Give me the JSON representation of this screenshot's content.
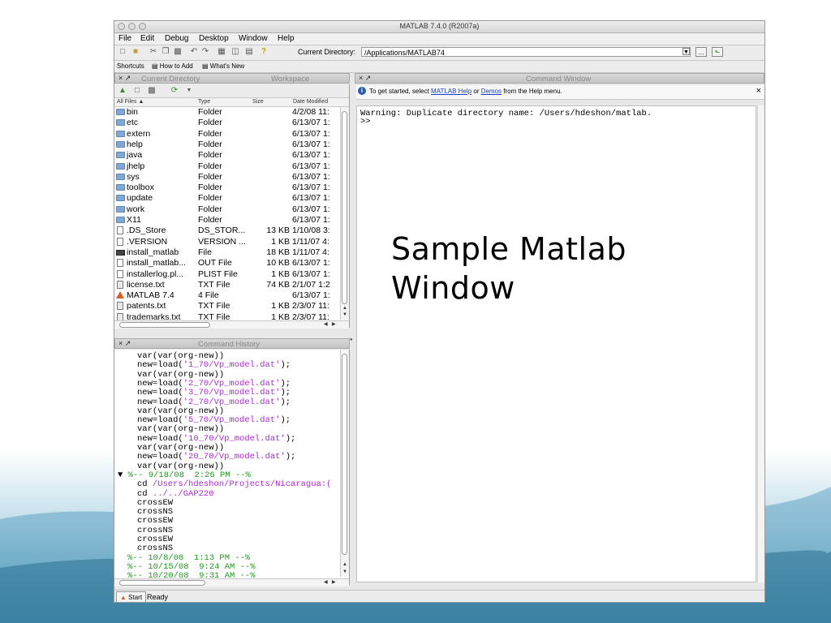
{
  "colors": {
    "slide_bg_top": "#ffffff",
    "slide_bg_bottom": "#3e86a8",
    "string_purple": "#b025d8",
    "comment_green": "#1e9a1e",
    "link_blue": "#1a3fcf"
  },
  "window": {
    "title": "MATLAB  7.4.0 (R2007a)"
  },
  "menu": [
    "File",
    "Edit",
    "Debug",
    "Desktop",
    "Window",
    "Help"
  ],
  "toolbar": {
    "icons": [
      "new-file-icon",
      "open-folder-icon",
      "cut-icon",
      "copy-icon",
      "paste-icon",
      "undo-icon",
      "redo-icon",
      "simulink-icon",
      "guide-icon",
      "profiler-icon",
      "help-icon"
    ],
    "current_directory_label": "Current Directory:",
    "current_directory_value": "/Applications/MATLAB74",
    "browse_label": "...",
    "up_label": "⬑"
  },
  "shortcuts": {
    "label": "Shortcuts",
    "items": [
      "How to Add",
      "What's New"
    ]
  },
  "current_directory_pane": {
    "tab_active": "Current Directory",
    "tab_inactive": "Workspace",
    "columns": [
      "All Files ▲",
      "Type",
      "Size",
      "Date Modified"
    ],
    "files": [
      {
        "name": "bin",
        "type": "Folder",
        "size": "",
        "date": "4/2/08 11:",
        "icon": "folder"
      },
      {
        "name": "etc",
        "type": "Folder",
        "size": "",
        "date": "6/13/07 1:",
        "icon": "folder"
      },
      {
        "name": "extern",
        "type": "Folder",
        "size": "",
        "date": "6/13/07 1:",
        "icon": "folder"
      },
      {
        "name": "help",
        "type": "Folder",
        "size": "",
        "date": "6/13/07 1:",
        "icon": "folder"
      },
      {
        "name": "java",
        "type": "Folder",
        "size": "",
        "date": "6/13/07 1:",
        "icon": "folder"
      },
      {
        "name": "jhelp",
        "type": "Folder",
        "size": "",
        "date": "6/13/07 1:",
        "icon": "folder"
      },
      {
        "name": "sys",
        "type": "Folder",
        "size": "",
        "date": "6/13/07 1:",
        "icon": "folder"
      },
      {
        "name": "toolbox",
        "type": "Folder",
        "size": "",
        "date": "6/13/07 1:",
        "icon": "folder"
      },
      {
        "name": "update",
        "type": "Folder",
        "size": "",
        "date": "6/13/07 1:",
        "icon": "folder"
      },
      {
        "name": "work",
        "type": "Folder",
        "size": "",
        "date": "6/13/07 1:",
        "icon": "folder"
      },
      {
        "name": "X11",
        "type": "Folder",
        "size": "",
        "date": "6/13/07 1:",
        "icon": "folder"
      },
      {
        "name": ".DS_Store",
        "type": "DS_STOR...",
        "size": "13 KB",
        "date": "1/10/08 3:",
        "icon": "file"
      },
      {
        "name": ".VERSION",
        "type": "VERSION ...",
        "size": "1 KB",
        "date": "1/11/07 4:",
        "icon": "file"
      },
      {
        "name": "install_matlab",
        "type": "File",
        "size": "18 KB",
        "date": "1/11/07 4:",
        "icon": "bin"
      },
      {
        "name": "install_matlab...",
        "type": "OUT File",
        "size": "10 KB",
        "date": "6/13/07 1:",
        "icon": "file"
      },
      {
        "name": "installerlog.pl...",
        "type": "PLIST File",
        "size": "1 KB",
        "date": "6/13/07 1:",
        "icon": "file"
      },
      {
        "name": "license.txt",
        "type": "TXT File",
        "size": "74 KB",
        "date": "2/1/07 1:2",
        "icon": "txt"
      },
      {
        "name": "MATLAB 7.4",
        "type": "4 File",
        "size": "",
        "date": "6/13/07 1:",
        "icon": "matlab"
      },
      {
        "name": "patents.txt",
        "type": "TXT File",
        "size": "1 KB",
        "date": "2/3/07 11:",
        "icon": "txt"
      },
      {
        "name": "trademarks.txt",
        "type": "TXT File",
        "size": "1 KB",
        "date": "2/3/07 11:",
        "icon": "txt"
      }
    ]
  },
  "command_history": {
    "title": "Command History",
    "lines": [
      {
        "indent": 2,
        "parts": [
          {
            "t": "var(var(org-new))",
            "c": "plain"
          }
        ]
      },
      {
        "indent": 2,
        "parts": [
          {
            "t": "new=load(",
            "c": "plain"
          },
          {
            "t": "'1_70/Vp_model.dat'",
            "c": "str"
          },
          {
            "t": ");",
            "c": "plain"
          }
        ]
      },
      {
        "indent": 2,
        "parts": [
          {
            "t": "var(var(org-new))",
            "c": "plain"
          }
        ]
      },
      {
        "indent": 2,
        "parts": [
          {
            "t": "new=load(",
            "c": "plain"
          },
          {
            "t": "'2_70/Vp_model.dat'",
            "c": "str"
          },
          {
            "t": ");",
            "c": "plain"
          }
        ]
      },
      {
        "indent": 2,
        "parts": [
          {
            "t": "new=load(",
            "c": "plain"
          },
          {
            "t": "'3_70/Vp_model.dat'",
            "c": "str"
          },
          {
            "t": ");",
            "c": "plain"
          }
        ]
      },
      {
        "indent": 2,
        "parts": [
          {
            "t": "new=load(",
            "c": "plain"
          },
          {
            "t": "'2_70/Vp_model.dat'",
            "c": "str"
          },
          {
            "t": ");",
            "c": "plain"
          }
        ]
      },
      {
        "indent": 2,
        "parts": [
          {
            "t": "var(var(org-new))",
            "c": "plain"
          }
        ]
      },
      {
        "indent": 2,
        "parts": [
          {
            "t": "new=load(",
            "c": "plain"
          },
          {
            "t": "'5_70/Vp_model.dat'",
            "c": "str"
          },
          {
            "t": ");",
            "c": "plain"
          }
        ]
      },
      {
        "indent": 2,
        "parts": [
          {
            "t": "var(var(org-new))",
            "c": "plain"
          }
        ]
      },
      {
        "indent": 2,
        "parts": [
          {
            "t": "new=load(",
            "c": "plain"
          },
          {
            "t": "'10_70/Vp_model.dat'",
            "c": "str"
          },
          {
            "t": ");",
            "c": "plain"
          }
        ]
      },
      {
        "indent": 2,
        "parts": [
          {
            "t": "var(var(org-new))",
            "c": "plain"
          }
        ]
      },
      {
        "indent": 2,
        "parts": [
          {
            "t": "new=load(",
            "c": "plain"
          },
          {
            "t": "'20_70/Vp_model.dat'",
            "c": "str"
          },
          {
            "t": ");",
            "c": "plain"
          }
        ]
      },
      {
        "indent": 2,
        "parts": [
          {
            "t": "var(var(org-new))",
            "c": "plain"
          }
        ]
      },
      {
        "indent": 0,
        "parts": [
          {
            "t": "▼ ",
            "c": "plain"
          },
          {
            "t": "%-- 9/18/08  2:26 PM --%",
            "c": "cmt"
          }
        ]
      },
      {
        "indent": 2,
        "parts": [
          {
            "t": "cd ",
            "c": "plain"
          },
          {
            "t": "/Users/hdeshon/Projects/Nicaragua:(",
            "c": "str"
          }
        ]
      },
      {
        "indent": 2,
        "parts": [
          {
            "t": "cd ",
            "c": "plain"
          },
          {
            "t": "../../GAP220",
            "c": "str"
          }
        ]
      },
      {
        "indent": 2,
        "parts": [
          {
            "t": "crossEW",
            "c": "plain"
          }
        ]
      },
      {
        "indent": 2,
        "parts": [
          {
            "t": "crossNS",
            "c": "plain"
          }
        ]
      },
      {
        "indent": 2,
        "parts": [
          {
            "t": "crossEW",
            "c": "plain"
          }
        ]
      },
      {
        "indent": 2,
        "parts": [
          {
            "t": "crossNS",
            "c": "plain"
          }
        ]
      },
      {
        "indent": 2,
        "parts": [
          {
            "t": "crossEW",
            "c": "plain"
          }
        ]
      },
      {
        "indent": 2,
        "parts": [
          {
            "t": "crossNS",
            "c": "plain"
          }
        ]
      },
      {
        "indent": 1,
        "parts": [
          {
            "t": "%-- 10/8/08  1:13 PM --%",
            "c": "cmt"
          }
        ]
      },
      {
        "indent": 1,
        "parts": [
          {
            "t": "%-- 10/15/08  9:24 AM --%",
            "c": "cmt"
          }
        ]
      },
      {
        "indent": 1,
        "parts": [
          {
            "t": "%-- 10/20/08  9:31 AM --%",
            "c": "cmt"
          }
        ]
      }
    ]
  },
  "command_window": {
    "title": "Command Window",
    "tip_prefix": "To get started, select ",
    "tip_link1": "MATLAB Help",
    "tip_mid": " or ",
    "tip_link2": "Demos",
    "tip_suffix": " from the Help menu.",
    "close_label": "×",
    "output": [
      "Warning: Duplicate directory name: /Users/hdeshon/matlab.",
      ">>"
    ]
  },
  "statusbar": {
    "start_label": "Start",
    "status": "Ready"
  },
  "slide_text": [
    "Sample Matlab",
    "Window"
  ]
}
